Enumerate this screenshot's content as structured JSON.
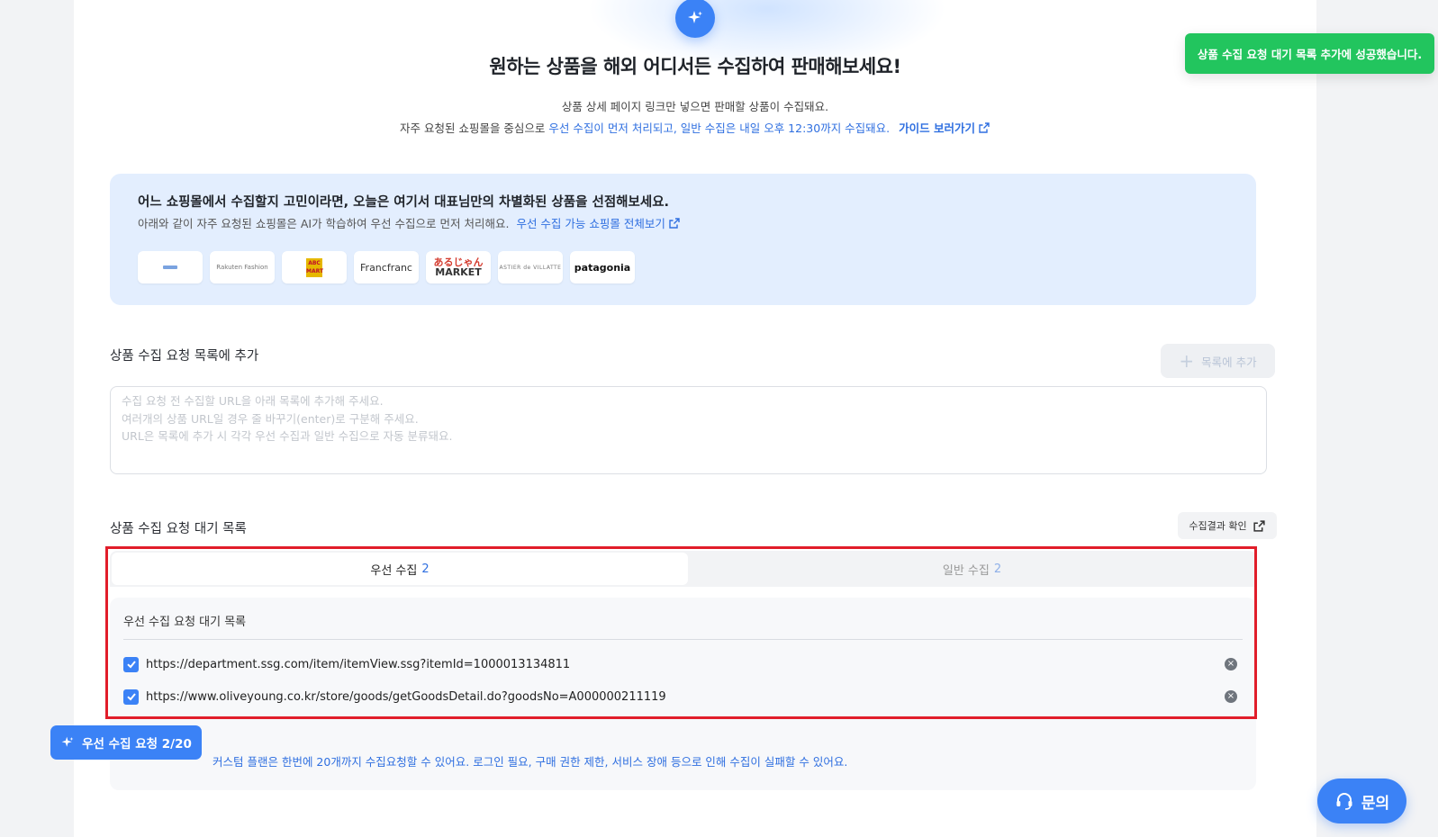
{
  "hero": {
    "title": "원하는 상품을 해외 어디서든 수집하여 판매해보세요!",
    "line1": "상품 상세 페이지 링크만 넣으면 판매할 상품이 수집돼요.",
    "line2_prefix": "자주 요청된 쇼핑몰을 중심으로",
    "line2_highlight": "우선 수집이 먼저 처리되고, 일반 수집은 내일 오후 12:30까지 수집돼요.",
    "guide_link": "가이드 보러가기",
    "icon": "sparkle-icon"
  },
  "info_box": {
    "title": "어느 쇼핑몰에서 수집할지 고민이라면, 오늘은 여기서 대표님만의 차별화된 상품을 선점해보세요.",
    "desc": "아래와 같이 자주 요청된 쇼핑몰은 AI가 학습하여 우선 수집으로 먼저 처리해요.",
    "link": "우선 수집 가능 쇼핑몰 전체보기",
    "logos": {
      "rakuten_fashion": "Rakuten Fashion",
      "abc_mart": "ABC MART",
      "francfranc": "Francfranc",
      "aru_market_top": "あるじゃん",
      "aru_market_bottom": "MARKET",
      "astier": "ASTIER de VILLATTE",
      "patagonia": "patagonia"
    }
  },
  "add_section": {
    "title": "상품 수집 요청 목록에 추가",
    "add_button": "목록에 추가",
    "placeholder": "수집 요청 전 수집할 URL을 아래 목록에 추가해 주세요.\n여러개의 상품 URL일 경우 줄 바꾸기(enter)로 구분해 주세요.\nURL은 목록에 추가 시 각각 우선 수집과 일반 수집으로 자동 분류돼요."
  },
  "waitlist": {
    "title": "상품 수집 요청 대기 목록",
    "result_button": "수집결과 확인",
    "tabs": {
      "priority": {
        "label": "우선 수집",
        "count": "2"
      },
      "general": {
        "label": "일반 수집",
        "count": "2"
      }
    },
    "list_title": "우선 수집 요청 대기 목록",
    "items": [
      {
        "url": "https://department.ssg.com/item/itemView.ssg?itemId=1000013134811",
        "checked": true
      },
      {
        "url": "https://www.oliveyoung.co.kr/store/goods/getGoodsDetail.do?goodsNo=A000000211119",
        "checked": true
      }
    ],
    "request_button": "우선 수집 요청 2/20",
    "note": "커스텀 플랜은 한번에 20개까지 수집요청할 수 있어요. 로그인 필요, 구매 권한 제한, 서비스 장애 등으로 인해 수집이 실패할 수 있어요."
  },
  "toast": "상품 수집 요청 대기 목록 추가에 성공했습니다.",
  "inquiry_button": "문의",
  "colors": {
    "accent": "#3b82f6",
    "success": "#22c55e",
    "highlight_border": "#e11d2a"
  }
}
